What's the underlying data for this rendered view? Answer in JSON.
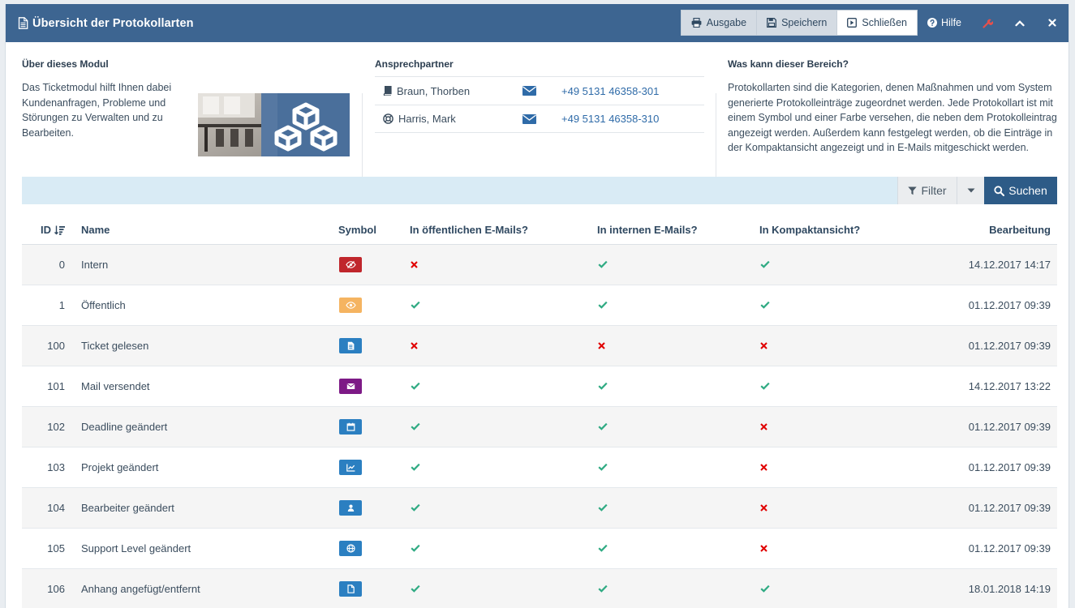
{
  "window": {
    "title": "Übersicht der Protokollarten"
  },
  "toolbar": {
    "ausgabe_label": "Ausgabe",
    "speichern_label": "Speichern",
    "schliessen_label": "Schließen",
    "hilfe_label": "Hilfe"
  },
  "info": {
    "module_heading": "Über dieses Modul",
    "module_text": "Das Ticketmodul hilft Ihnen dabei Kundenanfragen, Probleme und Störungen zu Verwalten und zu Bearbeiten.",
    "contacts_heading": "Ansprechpartner",
    "contacts": [
      {
        "name": "Braun, Thorben",
        "icon": "book-icon",
        "phone": "+49 5131 46358-301"
      },
      {
        "name": "Harris, Mark",
        "icon": "lifebuoy-icon",
        "phone": "+49 5131 46358-310"
      }
    ],
    "area_heading": "Was kann dieser Bereich?",
    "area_text": "Protokollarten sind die Kategorien, denen Maßnahmen und vom System generierte Protokolleinträge zugeordnet werden. Jede Protokollart ist mit einem Symbol und einer Farbe versehen, die neben dem Protokolleintrag angezeigt werden. Außerdem kann festgelegt werden, ob die Einträge in der Kompaktansicht angezeigt und in E-Mails mitgeschickt werden."
  },
  "filterbar": {
    "filter_label": "Filter",
    "search_label": "Suchen"
  },
  "table": {
    "headers": {
      "id": "ID",
      "name": "Name",
      "symbol": "Symbol",
      "public_mail": "In öffentlichen E-Mails?",
      "internal_mail": "In internen E-Mails?",
      "compact": "In Kompaktansicht?",
      "edited": "Bearbeitung"
    },
    "rows": [
      {
        "id": "0",
        "name": "Intern",
        "symbol": "eye-slash-icon",
        "color": "#c0262c",
        "pub": false,
        "int": true,
        "comp": true,
        "date": "14.12.2017 14:17"
      },
      {
        "id": "1",
        "name": "Öffentlich",
        "symbol": "eye-icon",
        "color": "#f5b461",
        "pub": true,
        "int": true,
        "comp": true,
        "date": "01.12.2017 09:39"
      },
      {
        "id": "100",
        "name": "Ticket gelesen",
        "symbol": "file-text-icon",
        "color": "#2b7fc1",
        "pub": false,
        "int": false,
        "comp": false,
        "date": "01.12.2017 09:39"
      },
      {
        "id": "101",
        "name": "Mail versendet",
        "symbol": "envelope-icon",
        "color": "#7d1a86",
        "pub": true,
        "int": true,
        "comp": true,
        "date": "14.12.2017 13:22"
      },
      {
        "id": "102",
        "name": "Deadline geändert",
        "symbol": "calendar-icon",
        "color": "#2b7fc1",
        "pub": true,
        "int": true,
        "comp": false,
        "date": "01.12.2017 09:39"
      },
      {
        "id": "103",
        "name": "Projekt geändert",
        "symbol": "line-chart-icon",
        "color": "#2b7fc1",
        "pub": true,
        "int": true,
        "comp": false,
        "date": "01.12.2017 09:39"
      },
      {
        "id": "104",
        "name": "Bearbeiter geändert",
        "symbol": "user-icon",
        "color": "#2b7fc1",
        "pub": true,
        "int": true,
        "comp": false,
        "date": "01.12.2017 09:39"
      },
      {
        "id": "105",
        "name": "Support Level geändert",
        "symbol": "globe-icon",
        "color": "#2b7fc1",
        "pub": true,
        "int": true,
        "comp": false,
        "date": "01.12.2017 09:39"
      },
      {
        "id": "106",
        "name": "Anhang angefügt/entfernt",
        "symbol": "file-icon",
        "color": "#2b7fc1",
        "pub": true,
        "int": true,
        "comp": true,
        "date": "18.01.2018 14:19"
      }
    ]
  },
  "colors": {
    "titlebar": "#3d6591",
    "check": "#2eaa82",
    "cross": "#e00000",
    "search_button": "#2d5b87",
    "filterbar": "#d9ebf5"
  }
}
